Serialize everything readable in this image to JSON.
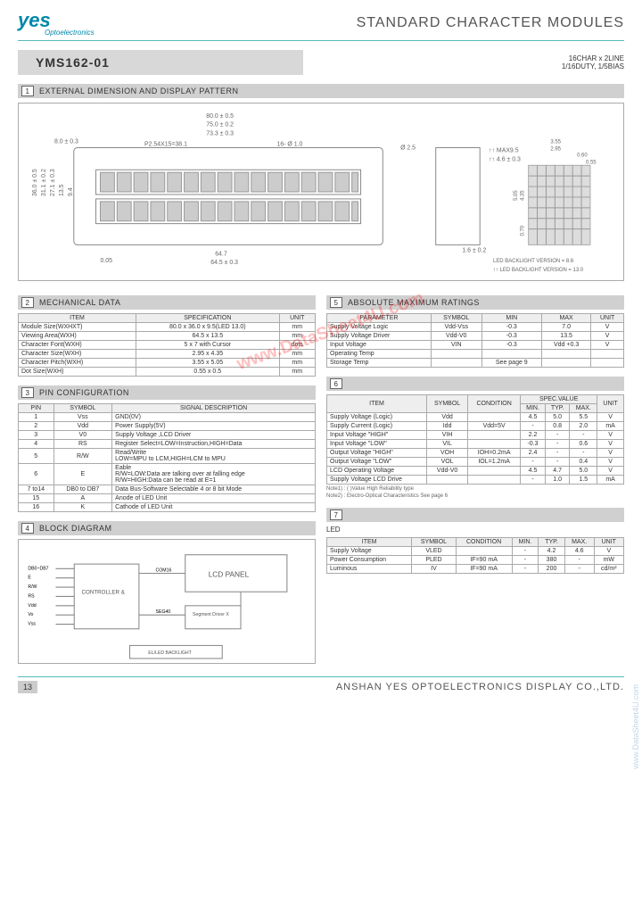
{
  "header": {
    "logo": "yes",
    "logo_sub": "Optoelectronics",
    "title": "STANDARD CHARACTER MODULES"
  },
  "model": {
    "name": "YMS162-01",
    "spec1": "16CHAR x 2LINE",
    "spec2": "1/16DUTY, 1/5BIAS"
  },
  "sections": {
    "s1": "EXTERNAL DIMENSION AND DISPLAY PATTERN",
    "s2": "MECHANICAL DATA",
    "s3": "PIN CONFIGURATION",
    "s4": "BLOCK DIAGRAM",
    "s5": "ABSOLUTE MAXIMUM RATINGS",
    "s6": "",
    "s7": ""
  },
  "dimensions": {
    "w1": "80.0 ± 0.5",
    "w2": "75.0 ± 0.2",
    "w3": "73.3 ± 0.3",
    "pitch": "P2.54X15=38.1",
    "hole": "16- Ø 1.0",
    "left": "8.0 ± 0.3",
    "char_note": "Ø 2.5",
    "max": "↑↑ MAX9.5",
    "depth": "↑↑ 4.6 ± 0.3",
    "h1": "36.0 ± 0.5",
    "h2": "31.1 ± 0.2",
    "h3": "27.1 ± 0.3",
    "h4": "13.5",
    "h5": "9.4",
    "btm": "0.05",
    "va_w": "64.7",
    "va_h": "64.5 ± 0.3",
    "bl1": "LED BACKLIGHT VERSION = 8.6",
    "bl2": "↑↑ LED BACKLIGHT VERSION = 13.0",
    "thk": "1.6 ± 0.2",
    "cw1": "3.55",
    "cw2": "2.95",
    "cw3": "0.60",
    "cw4": "0.55",
    "ch1": "5.05",
    "ch2": "4.35",
    "ch3": "0.70"
  },
  "mechanical": {
    "headers": [
      "ITEM",
      "SPECIFICATION",
      "UNIT"
    ],
    "rows": [
      [
        "Module Size(WXHXT)",
        "80.0 x 36.0 x 9.5(LED 13.0)",
        "mm"
      ],
      [
        "Viewing Area(WXH)",
        "64.5 x 13.5",
        "mm"
      ],
      [
        "Character Font(WXH)",
        "5 x 7 with Cursor",
        "dots"
      ],
      [
        "Character Size(WXH)",
        "2.95 x 4.35",
        "mm"
      ],
      [
        "Character Pitch(WXH)",
        "3.55 x 5.05",
        "mm"
      ],
      [
        "Dot Size(WXH)",
        "0.55 x 0.5",
        "mm"
      ]
    ]
  },
  "pinconfig": {
    "headers": [
      "PIN",
      "SYMBOL",
      "SIGNAL DESCRIPTION"
    ],
    "rows": [
      [
        "1",
        "Vss",
        "GND(0V)"
      ],
      [
        "2",
        "Vdd",
        "Power Supply(5V)"
      ],
      [
        "3",
        "V0",
        "Supply Voltage ,LCD Driver"
      ],
      [
        "4",
        "RS",
        "Register Select=LOW=Instruction,HIGH=Data"
      ],
      [
        "5",
        "R/W",
        "Read/Write\nLOW=MPU to LCM,HIGH=LCM to MPU"
      ],
      [
        "6",
        "E",
        "Eable\nR/W=LOW:Data are talking over at falling edge\nR/W=HIGH:Data can be read at E=1"
      ],
      [
        "7 to14",
        "DB0 to DB7",
        "Data Bus-Software Selectable 4 or 8 bit Mode"
      ],
      [
        "15",
        "A",
        "Anode of LED Unit"
      ],
      [
        "16",
        "K",
        "Cathode of LED Unit"
      ]
    ]
  },
  "absmax": {
    "headers": [
      "PARAMETER",
      "SYMBOL",
      "MIN",
      "MAX",
      "UNIT"
    ],
    "rows": [
      [
        "Supply Voltage Logic",
        "Vdd-Vss",
        "-0.3",
        "7.0",
        "V"
      ],
      [
        "Supply Voltage Driver",
        "Vdd-V0",
        "-0.3",
        "13.5",
        "V"
      ],
      [
        "Input Voltage",
        "VIN",
        "-0.3",
        "Vdd +0.3",
        "V"
      ],
      [
        "Operating Temp",
        "",
        "",
        "",
        ""
      ],
      [
        "Storage Temp",
        "",
        "See page 9",
        "",
        ""
      ]
    ]
  },
  "electrical": {
    "headers": [
      "ITEM",
      "SYMBOL",
      "CONDITION",
      "MIN.",
      "TYP.",
      "MAX.",
      "UNIT"
    ],
    "rows": [
      [
        "Supply Voltage (Logic)",
        "Vdd",
        "",
        "4.5",
        "5.0",
        "5.5",
        "V"
      ],
      [
        "Supply Current (Logic)",
        "Idd",
        "Vdd=5V",
        "-",
        "0.8",
        "2.0",
        "mA"
      ],
      [
        "Input Voltage \"HIGH\"",
        "VIH",
        "",
        "2.2",
        "-",
        "-",
        "V"
      ],
      [
        "Input Voltage \"LOW\"",
        "VIL",
        "",
        "-0.3",
        "-",
        "0.6",
        "V"
      ],
      [
        "Output Voltage \"HIGH\"",
        "VOH",
        "IOH=0.2mA",
        "2.4",
        "-",
        "-",
        "V"
      ],
      [
        "Output Voltage \"LOW\"",
        "VOL",
        "IOL=1.2mA",
        "-",
        "-",
        "0.4",
        "V"
      ],
      [
        "LCD Operating Voltage",
        "Vdd-V0",
        "",
        "4.5",
        "4.7",
        "5.0",
        "V"
      ],
      [
        "Supply Voltage LCD Drive",
        "",
        "",
        "-",
        "1.0",
        "1.5",
        "mA"
      ]
    ],
    "note1": "Note1) : ( )Value High Reliability type",
    "note2": "Note2) : Electro-Optical Characteristics See page 6"
  },
  "led": {
    "title": "LED",
    "headers": [
      "ITEM",
      "SYMBOL",
      "CONDITION",
      "MIN.",
      "TYP.",
      "MAX.",
      "UNIT"
    ],
    "rows": [
      [
        "Supply Voltage",
        "VLED",
        "",
        "-",
        "4.2",
        "4.6",
        "V"
      ],
      [
        "Power Consumption",
        "PLED",
        "IF=90 mA",
        "-",
        "380",
        "-",
        "mW"
      ],
      [
        "Luminous",
        "IV",
        "IF=90 mA",
        "-",
        "200",
        "-",
        "cd/m²"
      ]
    ]
  },
  "blockdiagram": {
    "lcd_panel": "LCD PANEL",
    "controller": "CONTROLLER &",
    "segment": "Segment Driver X",
    "backlight": "EL/LED BACKLIGHT",
    "sig_db": "DB0~DB7",
    "sig_e": "E",
    "sig_rw": "R/W",
    "sig_rs": "RS",
    "sig_vdd": "Vdd",
    "sig_vo": "Vo",
    "sig_vss": "Vss",
    "com": "COM16",
    "seg": "SEG40"
  },
  "footer": {
    "page": "13",
    "company": "ANSHAN YES OPTOELECTRONICS DISPLAY CO.,LTD."
  },
  "watermark": "www.DataSheet4U.com",
  "side_watermark": "www.DataSheet4U.com"
}
